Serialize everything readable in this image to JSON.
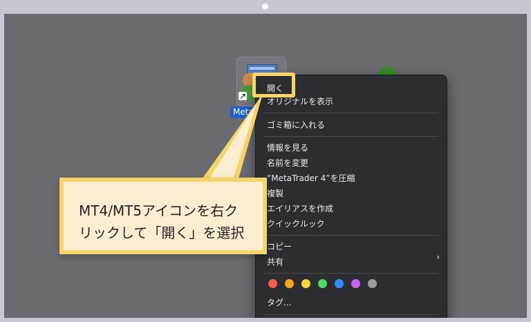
{
  "desktop": {
    "icon_label": "Meta",
    "alias_glyph": "↗"
  },
  "context_menu": {
    "items": [
      {
        "label": "開く"
      },
      {
        "label": "オリジナルを表示"
      },
      {
        "label": "ゴミ箱に入れる"
      },
      {
        "label": "情報を見る"
      },
      {
        "label": "名前を変更"
      },
      {
        "label": "“MetaTrader 4”を圧縮"
      },
      {
        "label": "複製"
      },
      {
        "label": "エイリアスを作成"
      },
      {
        "label": "クイックルック"
      },
      {
        "label": "コピー"
      },
      {
        "label": "共有"
      },
      {
        "label": "タグ..."
      }
    ],
    "submenu_chevron": "›",
    "tag_colors": [
      "#f25c54",
      "#f5a623",
      "#f8d93a",
      "#4cd964",
      "#2f8cff",
      "#c565f2",
      "#9d9da3"
    ]
  },
  "callout": {
    "line1": "MT4/MT5アイコンを右ク",
    "line2": "リックして「開く」を選択",
    "highlight_color": "#f5d46a",
    "bg_color": "#fbeed0"
  }
}
